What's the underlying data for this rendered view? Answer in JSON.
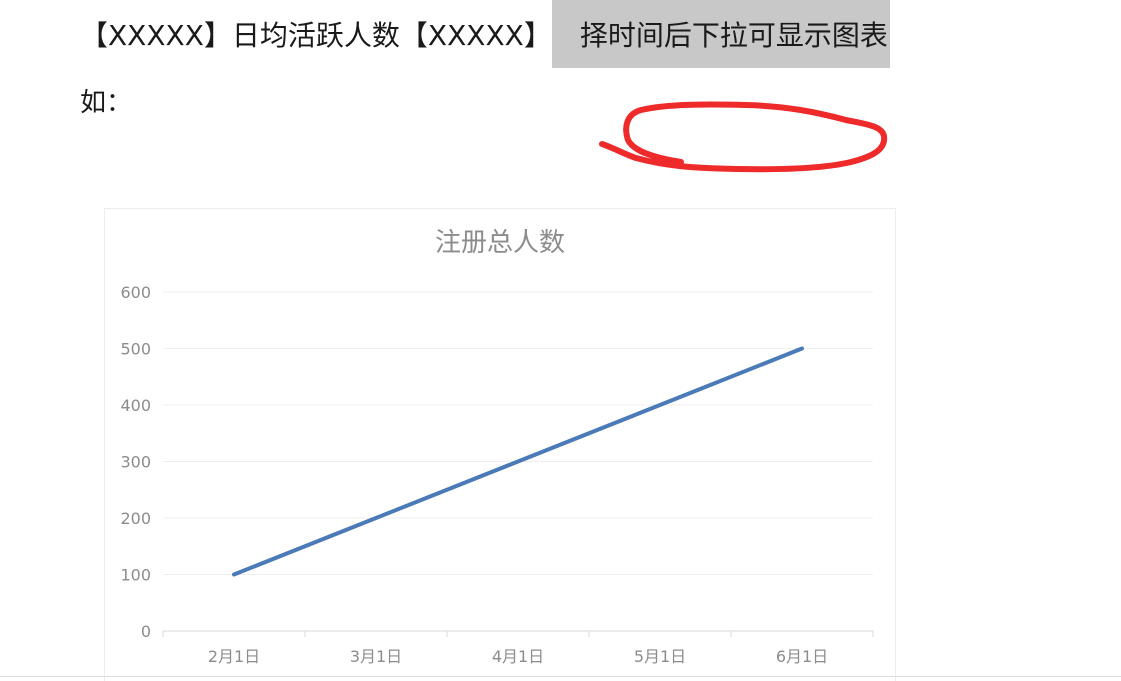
{
  "document": {
    "line1_plain": "【XXXXX】日均活跃人数【XXXXX】选",
    "line1_highlighted": "择时间后下拉可显示图表",
    "line2": "如："
  },
  "colors": {
    "highlight": "#c8c8c8",
    "annotation": "#ee2a2a",
    "series_line": "#4a7ab8",
    "axis_text": "#8c8c8c",
    "grid": "#efefef"
  },
  "chart_data": {
    "type": "line",
    "title": "注册总人数",
    "categories": [
      "2月1日",
      "3月1日",
      "4月1日",
      "5月1日",
      "6月1日"
    ],
    "series": [
      {
        "values": [
          100,
          200,
          300,
          400,
          500
        ]
      }
    ],
    "ylim": [
      0,
      600
    ],
    "yticks": [
      "0",
      "100",
      "200",
      "300",
      "400",
      "500",
      "600"
    ],
    "grid": true,
    "legend": "none"
  }
}
